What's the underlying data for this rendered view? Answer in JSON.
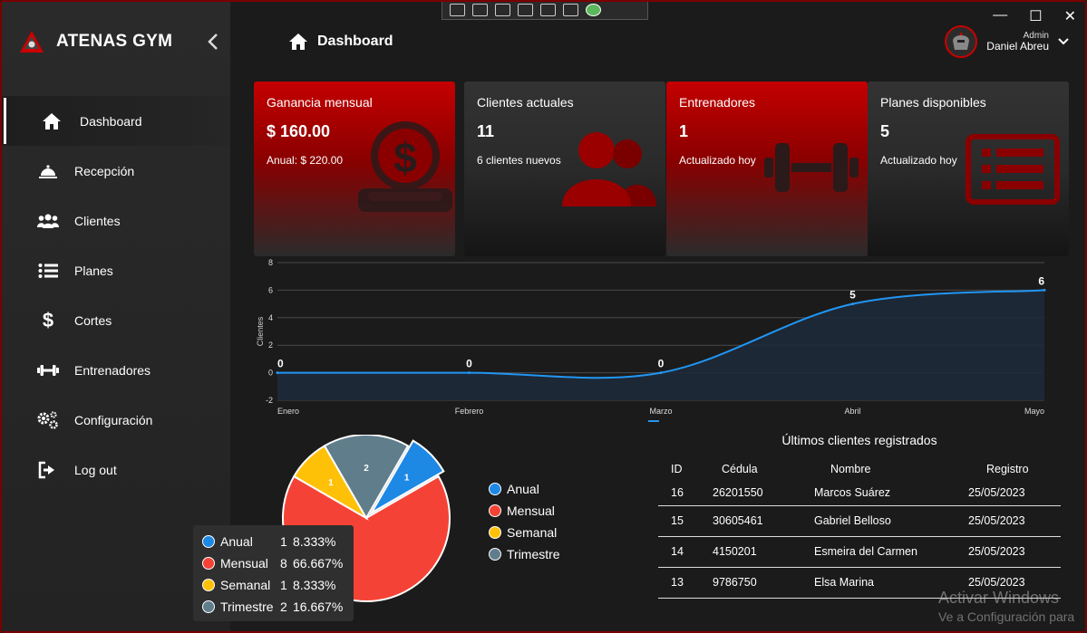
{
  "app": {
    "title": "ATENAS GYM",
    "collapse_icon": "chevron-left-icon"
  },
  "window": {
    "minimize": "—",
    "maximize": "☐",
    "close": "✕"
  },
  "sidebar": {
    "items": [
      {
        "label": "Dashboard",
        "icon": "home-icon",
        "active": true
      },
      {
        "label": "Recepción",
        "icon": "bell-icon"
      },
      {
        "label": "Clientes",
        "icon": "users-icon"
      },
      {
        "label": "Planes",
        "icon": "list-icon"
      },
      {
        "label": "Cortes",
        "icon": "dollar-icon"
      },
      {
        "label": "Entrenadores",
        "icon": "dumbbell-icon"
      },
      {
        "label": "Configuración",
        "icon": "gears-icon"
      },
      {
        "label": "Log out",
        "icon": "logout-icon"
      }
    ]
  },
  "header": {
    "title": "Dashboard"
  },
  "user": {
    "role": "Admin",
    "name": "Daniel Abreu"
  },
  "cards": [
    {
      "title": "Ganancia mensual",
      "value": "$ 160.00",
      "sub": "Anual: $ 220.00",
      "style": "red",
      "icon": "money-hand-icon"
    },
    {
      "title": "Clientes actuales",
      "value": "11",
      "sub": "6 clientes nuevos",
      "style": "dark",
      "icon": "users-icon"
    },
    {
      "title": "Entrenadores",
      "value": "1",
      "sub": "Actualizado hoy",
      "style": "red",
      "icon": "dumbbell-icon"
    },
    {
      "title": "Planes disponibles",
      "value": "5",
      "sub": "Actualizado hoy",
      "style": "dark",
      "icon": "list-icon"
    }
  ],
  "chart_data": [
    {
      "type": "area",
      "x": [
        "Enero",
        "Febrero",
        "Marzo",
        "Abril",
        "Mayo"
      ],
      "series": [
        {
          "values": [
            0,
            0,
            0,
            5,
            6
          ]
        }
      ],
      "data_labels": [
        "0",
        "0",
        "0",
        "5",
        "6"
      ],
      "ylabel": "Clientes",
      "ylim": [
        -2,
        8
      ],
      "yticks": [
        "8",
        "6",
        "4",
        "2",
        "0",
        "-2"
      ],
      "grid": true
    },
    {
      "type": "pie",
      "categories": [
        "Anual",
        "Mensual",
        "Semanal",
        "Trimestre"
      ],
      "values": [
        1,
        8,
        1,
        2
      ],
      "percent_labels": [
        "8.333%",
        "66.667%",
        "8.333%",
        "16.667%"
      ],
      "colors": [
        "#1e88e5",
        "#f44336",
        "#ffc107",
        "#607d8b"
      ],
      "slice_labels": [
        "1",
        "",
        "1",
        "2"
      ]
    }
  ],
  "table": {
    "title": "Últimos clientes registrados",
    "headers": [
      "ID",
      "Cédula",
      "Nombre",
      "Registro"
    ],
    "rows": [
      [
        "16",
        "26201550",
        "Marcos Suárez",
        "25/05/2023"
      ],
      [
        "15",
        "30605461",
        "Gabriel Belloso",
        "25/05/2023"
      ],
      [
        "14",
        "4150201",
        "Esmeira del Carmen",
        "25/05/2023"
      ],
      [
        "13",
        "9786750",
        "Elsa Marina",
        "25/05/2023"
      ]
    ]
  },
  "watermark": {
    "line1": "Activar Windows",
    "line2": "Ve a Configuración para"
  }
}
